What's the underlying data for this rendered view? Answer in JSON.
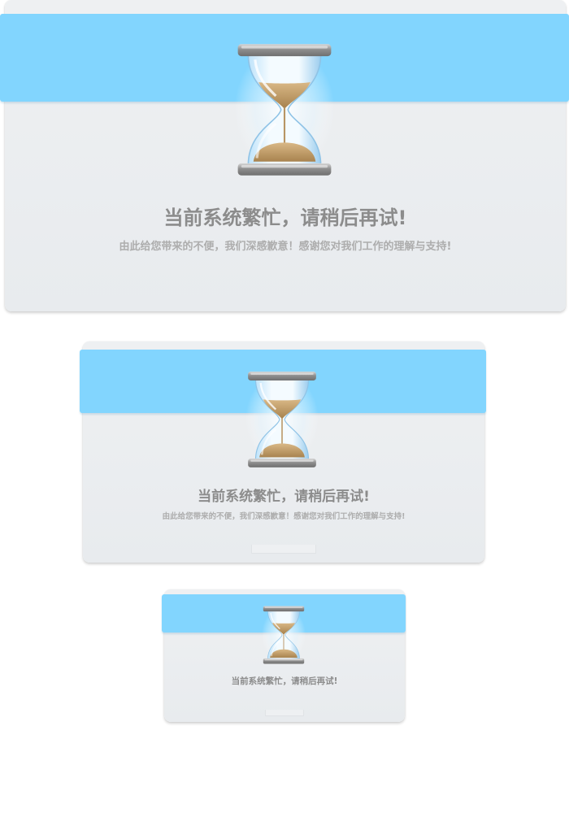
{
  "colors": {
    "band": "#82d5fe",
    "card": "#ebeef1",
    "title": "#8c8c8c",
    "subtitle": "#adadad",
    "sand": "#b89564",
    "cap": "#9a9a9a"
  },
  "icons": {
    "hourglass": "hourglass-icon"
  },
  "cards": [
    {
      "size": "large",
      "title": "当前系统繁忙，请稍后再试!",
      "subtitle": "由此给您带来的不便，我们深感歉意！感谢您对我们工作的理解与支持!"
    },
    {
      "size": "medium",
      "title": "当前系统繁忙，请稍后再试!",
      "subtitle": "由此给您带来的不便，我们深感歉意！感谢您对我们工作的理解与支持!"
    },
    {
      "size": "small",
      "title": "当前系统繁忙，请稍后再试!"
    }
  ]
}
